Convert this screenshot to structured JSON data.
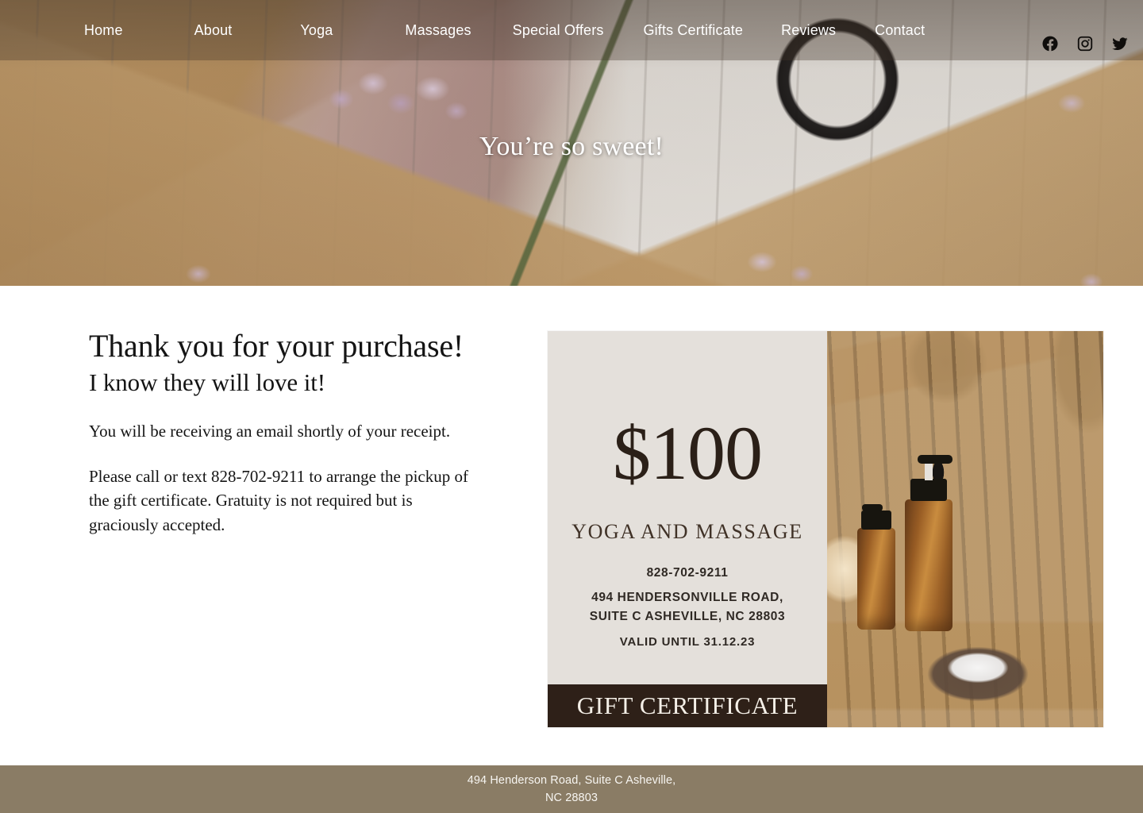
{
  "nav": {
    "items": [
      {
        "label": "Home"
      },
      {
        "label": "About"
      },
      {
        "label": "Yoga"
      },
      {
        "label": "Massages"
      },
      {
        "label": "Special Offers"
      },
      {
        "label": "Gifts Certificate"
      },
      {
        "label": "Reviews"
      },
      {
        "label": "Contact"
      }
    ],
    "social": [
      {
        "name": "facebook-icon"
      },
      {
        "name": "instagram-icon"
      },
      {
        "name": "twitter-icon"
      }
    ]
  },
  "hero": {
    "title": "You’re so sweet!",
    "image_description": "Kraft paper gift boxes tied with twine, lilac blossoms and pink fabric on weathered white wood"
  },
  "main": {
    "headline": "Thank you for your purchase!",
    "subheadline": "I know they will love it!",
    "paragraph_1": "You will be receiving an email shortly of your receipt.",
    "paragraph_2": "Please call or text 828-702-9211 to arrange the pickup of the gift certificate. Gratuity is not required but is graciously accepted."
  },
  "certificate": {
    "amount": "$100",
    "service": "YOGA AND MASSAGE",
    "phone": "828-702-9211",
    "address_line_1": "494 HENDERSONVILLE ROAD,",
    "address_line_2": "SUITE C ASHEVILLE, NC 28803",
    "valid_until": "VALID UNTIL 31.12.23",
    "banner": "GIFT CERTIFICATE",
    "image_description": "Woman in a white robe holding a bamboo tray with amber pump bottles, a bowl of bath salt and a lit candle"
  },
  "footer": {
    "line_1": "494 Henderson Road, Suite C Asheville,",
    "line_2": "NC 28803"
  },
  "colors": {
    "footer_background": "#8a7c65",
    "certificate_background": "#e3dfda",
    "certificate_banner": "#2e2018",
    "certificate_text": "#2b2018",
    "nav_text": "#ffffff"
  }
}
